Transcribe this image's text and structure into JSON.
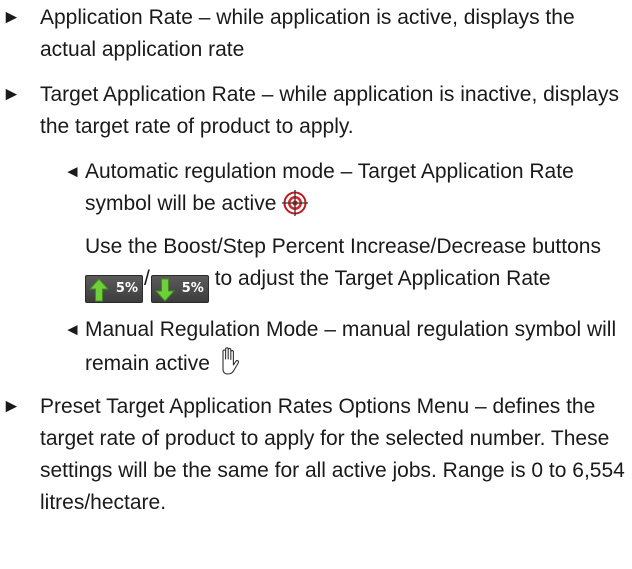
{
  "items": [
    {
      "marker": "►",
      "text": "Application Rate – while application is active, displays the actual application rate"
    },
    {
      "marker": "►",
      "text": "Target Application Rate – while application is inactive, displays the target rate of product to apply."
    },
    {
      "marker": "►",
      "text": "Preset Target Application Rates Options Menu – defines the target rate of product to apply for the selected number. These settings will be the same for all active jobs. Range is 0 to 6,554 litres/hectare."
    }
  ],
  "sub_items": [
    {
      "marker": "◄",
      "text": "Automatic regulation mode – Target Application Rate symbol will be active",
      "icon": "target-icon"
    },
    {
      "marker": "◄",
      "text": "Manual Regulation Mode – manual regulation symbol will remain active",
      "icon": "hand-icon"
    }
  ],
  "boost_paragraph": {
    "before": "Use the Boost/Step Percent Increase/Decrease buttons",
    "separator": "/",
    "after": "to adjust the Target Application Rate"
  },
  "buttons": {
    "increase_label": "5%",
    "decrease_label": "5%",
    "increase_icon": "arrow-up-icon",
    "decrease_icon": "arrow-down-icon"
  },
  "colors": {
    "text": "#1a1a1a",
    "button_bg": "#4a4a4a",
    "arrow_green": "#6fcf3a",
    "target_red": "#d6262b"
  }
}
